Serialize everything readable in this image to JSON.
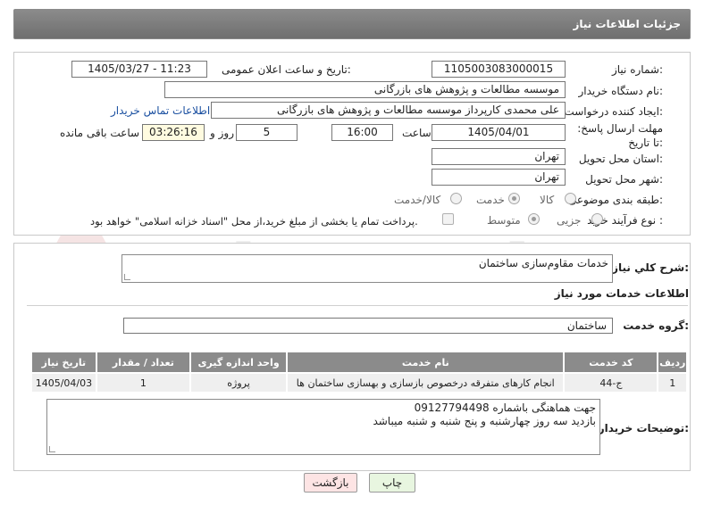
{
  "header": {
    "title": "جزئیات اطلاعات نیاز"
  },
  "form": {
    "need_number_label": "شماره نیاز:",
    "need_number": "1105003083000015",
    "announce_label": "تاریخ و ساعت اعلان عمومی:",
    "announce_value": "1405/03/27 - 11:23",
    "buyer_org_label": "نام دستگاه خریدار:",
    "buyer_org": "موسسه مطالعات و پژوهش های بازرگانی",
    "requester_label": "ایجاد کننده درخواست:",
    "requester": "علی محمدی کارپرداز موسسه مطالعات و پژوهش های بازرگانی",
    "buyer_contact_link": "اطلاعات تماس خریدار",
    "deadline_label": "مهلت ارسال پاسخ: تا تاریخ:",
    "deadline_date": "1405/04/01",
    "time_label": "ساعت",
    "deadline_time": "16:00",
    "days_value": "5",
    "days_label": "روز و",
    "remaining_time": "03:26:16",
    "remaining_label": "ساعت باقی مانده",
    "province_label": "استان محل تحویل:",
    "province": "تهران",
    "city_label": "شهر محل تحویل:",
    "city": "تهران",
    "category_label": "طبقه بندی موضوعی:",
    "category_options": [
      "کالا",
      "خدمت",
      "کالا/خدمت"
    ],
    "category_selected": "خدمت",
    "purchase_type_label": "نوع فرآیند خرید :",
    "purchase_options": [
      "جزیی",
      "متوسط"
    ],
    "purchase_selected": "متوسط",
    "payment_note": "پرداخت تمام یا بخشی از مبلغ خرید،از محل \"اسناد خزانه اسلامی\" خواهد بود."
  },
  "summary": {
    "label": "شرح کلي نياز:",
    "value": "خدمات مقاوم‌سازی ساختمان"
  },
  "services_info_title": "اطلاعات خدمات مورد نیاز",
  "service_group": {
    "label": "گروه خدمت:",
    "value": "ساختمان"
  },
  "table": {
    "headers": [
      "ردیف",
      "کد خدمت",
      "نام خدمت",
      "واحد اندازه گیری",
      "تعداد / مقدار",
      "تاریخ نیاز"
    ],
    "rows": [
      [
        "1",
        "ج-44",
        "انجام کارهای متفرقه درخصوص بازسازی و بهسازی ساختمان ها",
        "پروژه",
        "1",
        "1405/04/03"
      ]
    ]
  },
  "buyer_notes": {
    "label": "توضیحات خریدار:",
    "line1": "جهت هماهنگی باشماره 09127794498",
    "line2": "بازدید سه روز چهارشنبه و پنج شنبه و شنبه میباشد"
  },
  "buttons": {
    "print": "چاپ",
    "back": "بازگشت"
  },
  "watermark": "AriaTender.neT",
  "colors": {
    "header_bg": "#7d7d7d",
    "back_button_bg": "#fde4e4",
    "print_button_bg": "#e8f6e0",
    "link": "#1a4fa0"
  }
}
